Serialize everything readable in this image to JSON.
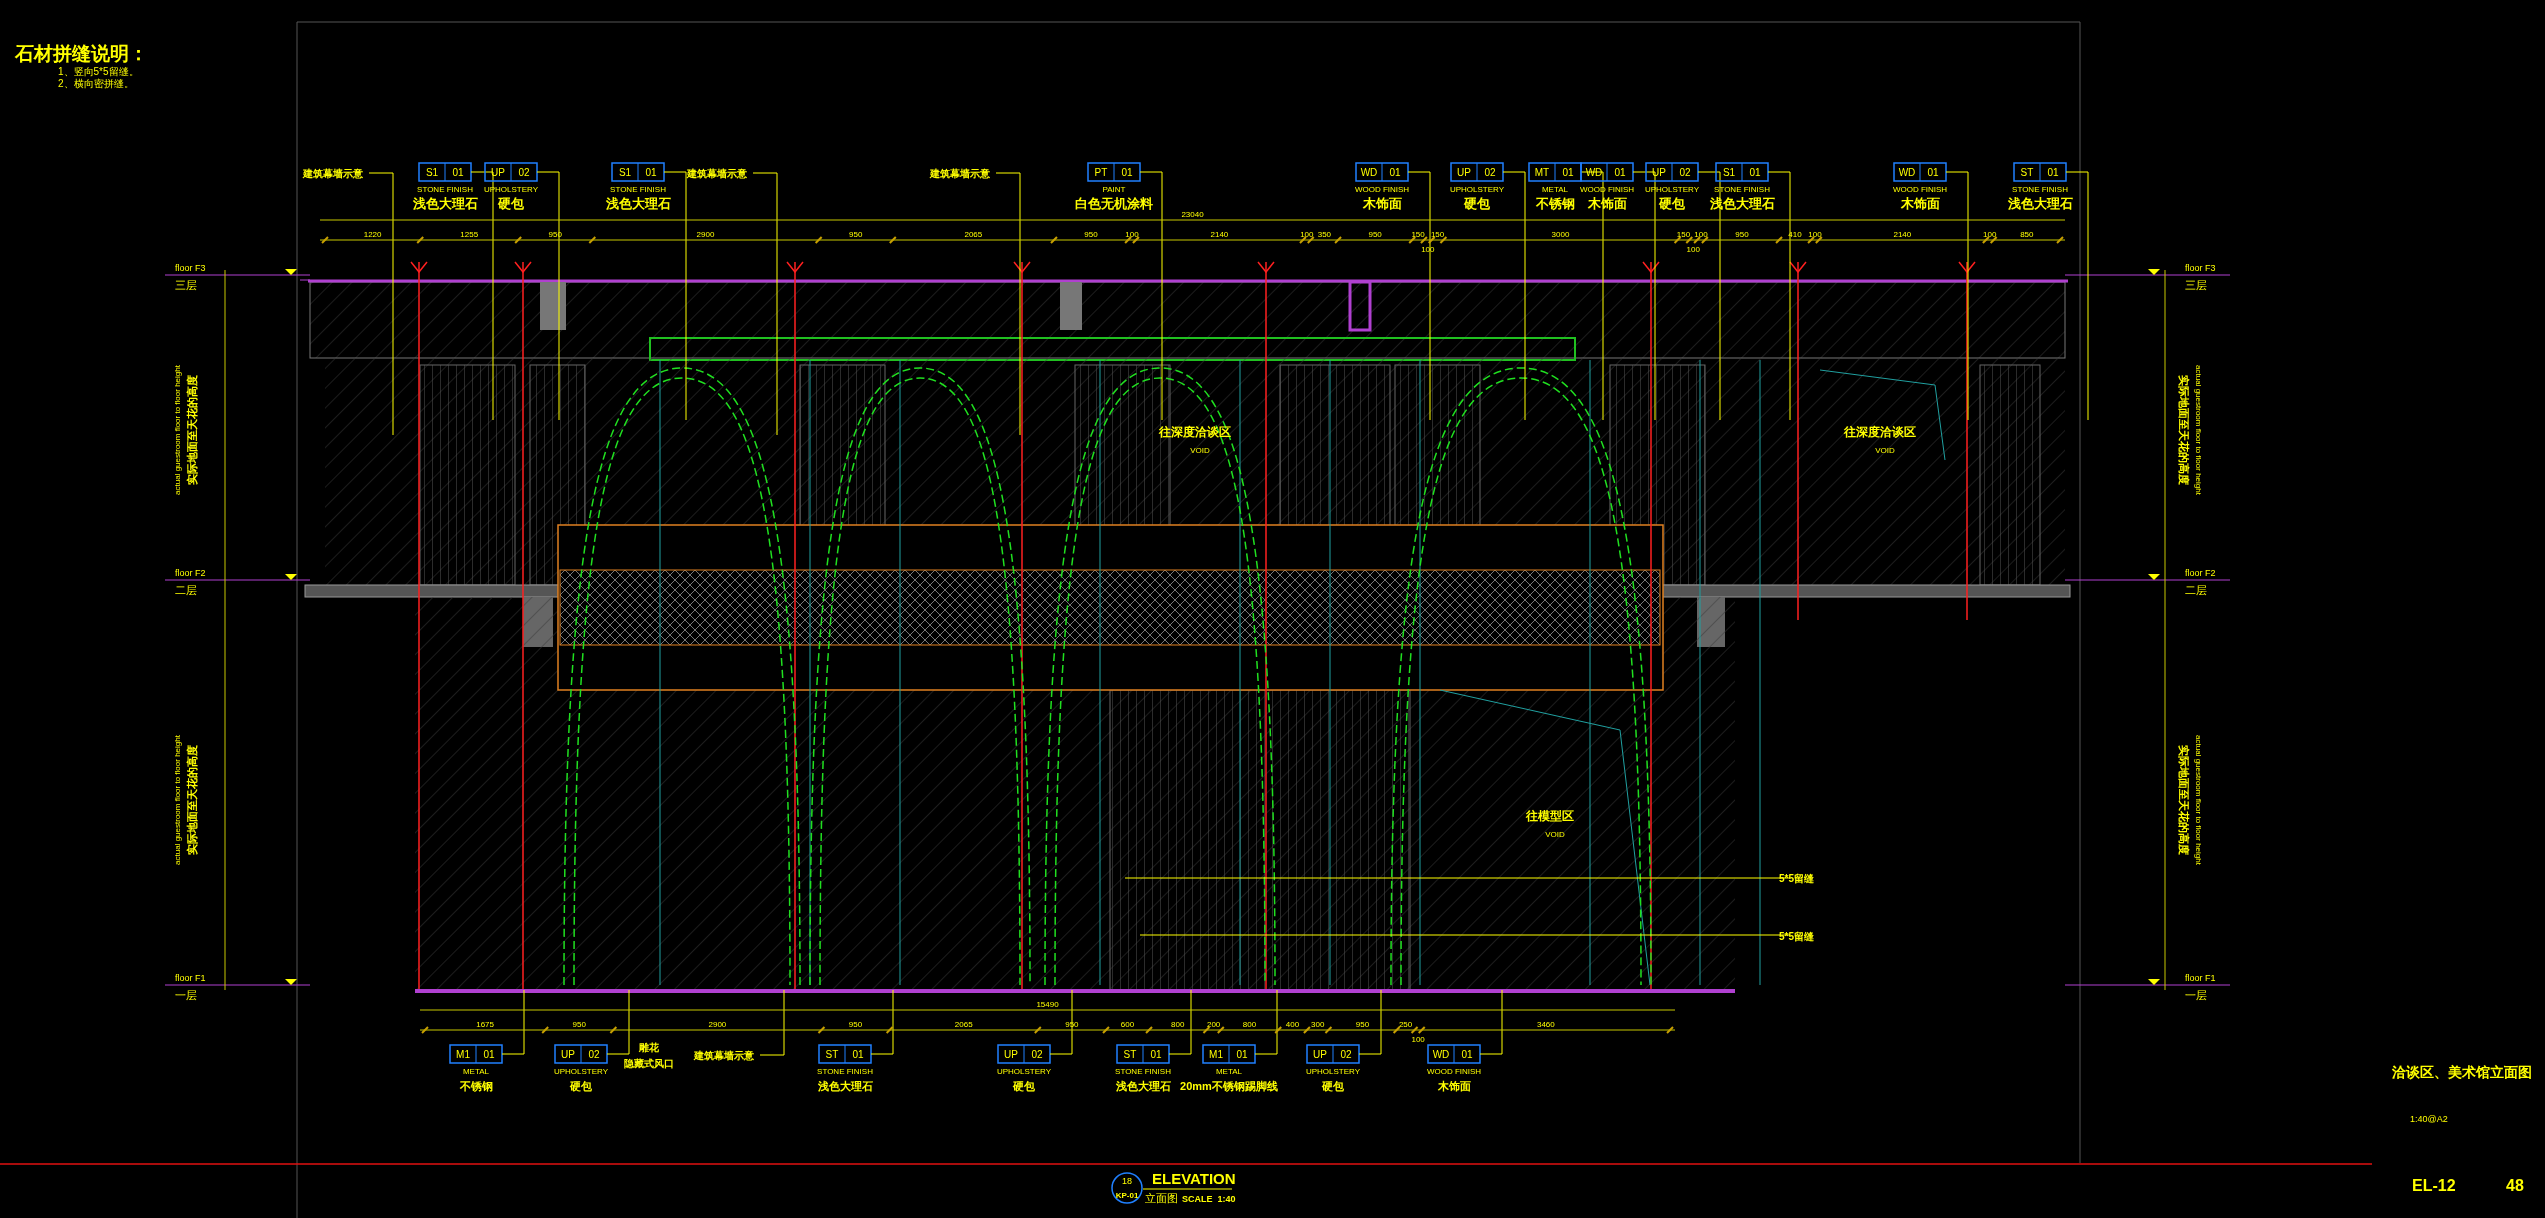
{
  "notes": {
    "title": "石材拼缝说明：",
    "items": [
      "1、竖向5*5留缝。",
      "2、横向密拼缝。"
    ]
  },
  "top_callouts": [
    {
      "kind": "note",
      "text": "建筑幕墙示意"
    },
    {
      "kind": "tag",
      "code": "S1",
      "number": "01",
      "category": "STONE FINISH",
      "material": "浅色大理石"
    },
    {
      "kind": "tag",
      "code": "UP",
      "number": "02",
      "category": "UPHOLSTERY",
      "material": "硬包"
    },
    {
      "kind": "tag",
      "code": "S1",
      "number": "01",
      "category": "STONE FINISH",
      "material": "浅色大理石"
    },
    {
      "kind": "note",
      "text": "建筑幕墙示意"
    },
    {
      "kind": "note",
      "text": "建筑幕墙示意"
    },
    {
      "kind": "tag",
      "code": "PT",
      "number": "01",
      "category": "PAINT",
      "material": "白色无机涂料"
    },
    {
      "kind": "tag",
      "code": "WD",
      "number": "01",
      "category": "WOOD FINISH",
      "material": "木饰面"
    },
    {
      "kind": "tag",
      "code": "UP",
      "number": "02",
      "category": "UPHOLSTERY",
      "material": "硬包"
    },
    {
      "kind": "tag",
      "code": "MT",
      "number": "01",
      "category": "METAL",
      "material": "不锈钢"
    },
    {
      "kind": "tag",
      "code": "WD",
      "number": "01",
      "category": "WOOD FINISH",
      "material": "木饰面"
    },
    {
      "kind": "tag",
      "code": "UP",
      "number": "02",
      "category": "UPHOLSTERY",
      "material": "硬包"
    },
    {
      "kind": "tag",
      "code": "S1",
      "number": "01",
      "category": "STONE FINISH",
      "material": "浅色大理石"
    },
    {
      "kind": "tag",
      "code": "WD",
      "number": "01",
      "category": "WOOD FINISH",
      "material": "木饰面"
    },
    {
      "kind": "tag",
      "code": "ST",
      "number": "01",
      "category": "STONE FINISH",
      "material": "浅色大理石"
    }
  ],
  "top_dimensions": {
    "total": "23040",
    "segments": [
      "1220",
      "1255",
      "950",
      "2900",
      "950",
      "2065",
      "950",
      "100",
      "2140",
      "100",
      "350",
      "950",
      "150",
      "100",
      "150",
      "3000",
      "150",
      "100",
      "100",
      "950",
      "410",
      "100",
      "2140",
      "100",
      "850"
    ]
  },
  "levels_left": [
    {
      "label": "floor F3",
      "name": "三层"
    },
    {
      "label": "floor F2",
      "name": "二层"
    },
    {
      "label": "floor F1",
      "name": "一层"
    }
  ],
  "levels_right": [
    {
      "label": "floor F3",
      "name": "三层"
    },
    {
      "label": "floor F2",
      "name": "二层"
    },
    {
      "label": "floor F1",
      "name": "一层"
    }
  ],
  "bottom_dimensions": {
    "total": "15490",
    "segments": [
      "1675",
      "950",
      "2900",
      "950",
      "2065",
      "950",
      "600",
      "800",
      "200",
      "800",
      "400",
      "300",
      "950",
      "250",
      "100",
      "3460"
    ]
  },
  "bottom_callouts": [
    {
      "kind": "tag",
      "code": "M1",
      "number": "01",
      "category": "METAL",
      "material": "不锈钢"
    },
    {
      "kind": "tag",
      "code": "UP",
      "number": "02",
      "category": "UPHOLSTERY",
      "material": "硬包"
    },
    {
      "kind": "note2",
      "text": "雕花",
      "text2": "隐藏式风口"
    },
    {
      "kind": "note",
      "text": "建筑幕墙示意"
    },
    {
      "kind": "tag",
      "code": "ST",
      "number": "01",
      "category": "STONE FINISH",
      "material": "浅色大理石"
    },
    {
      "kind": "tag",
      "code": "UP",
      "number": "02",
      "category": "UPHOLSTERY",
      "material": "硬包"
    },
    {
      "kind": "tag",
      "code": "ST",
      "number": "01",
      "category": "STONE FINISH",
      "material": "浅色大理石"
    },
    {
      "kind": "tag",
      "code": "M1",
      "number": "01",
      "category": "METAL",
      "material": "20mm不锈钢踢脚线"
    },
    {
      "kind": "tag",
      "code": "UP",
      "number": "02",
      "category": "UPHOLSTERY",
      "material": "硬包"
    },
    {
      "kind": "tag",
      "code": "WD",
      "number": "01",
      "category": "WOOD FINISH",
      "material": "木饰面"
    }
  ],
  "area_labels": [
    {
      "name": "往深度洽谈区",
      "note": "VOID"
    },
    {
      "name": "往深度洽谈区",
      "note": "VOID"
    },
    {
      "name": "往模型区",
      "note": "VOID"
    }
  ],
  "joint_labels": [
    "5*5留缝",
    "5*5留缝"
  ],
  "height_notes": [
    {
      "english": "actual guestroom floor to floor height",
      "chinese": "实际地面至天花的高度"
    },
    {
      "english": "actual guestroom floor to floor height",
      "chinese": "实际地面至天花的高度"
    },
    {
      "english": "actual guestroom floor to floor height",
      "chinese": "实际地面至天花的高度"
    },
    {
      "english": "actual guestroom floor to floor height",
      "chinese": "实际地面至天花的高度"
    }
  ],
  "elevation_title": {
    "number": "18",
    "sheet": "KP-01",
    "title": "ELEVATION",
    "subtitle": "立面图",
    "scale": "SCALE  1:40"
  },
  "title_block": {
    "drawing_name": "洽谈区、美术馆立面图",
    "scale": "1:40@A2",
    "sheet_no": "EL-12",
    "page": "48"
  }
}
